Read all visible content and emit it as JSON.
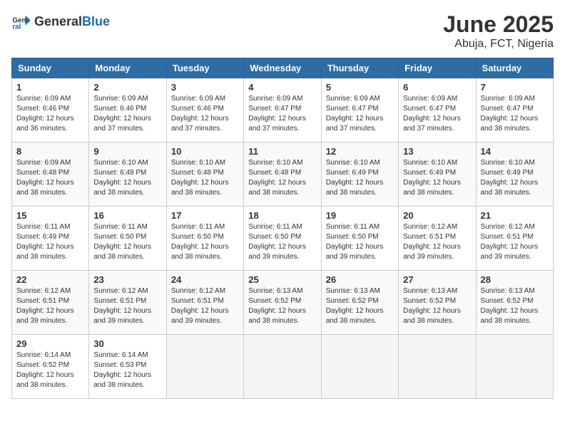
{
  "header": {
    "logo_general": "General",
    "logo_blue": "Blue",
    "title": "June 2025",
    "subtitle": "Abuja, FCT, Nigeria"
  },
  "calendar": {
    "columns": [
      "Sunday",
      "Monday",
      "Tuesday",
      "Wednesday",
      "Thursday",
      "Friday",
      "Saturday"
    ],
    "rows": [
      [
        {
          "day": "1",
          "sunrise": "6:09 AM",
          "sunset": "6:46 PM",
          "daylight": "12 hours and 36 minutes."
        },
        {
          "day": "2",
          "sunrise": "6:09 AM",
          "sunset": "6:46 PM",
          "daylight": "12 hours and 37 minutes."
        },
        {
          "day": "3",
          "sunrise": "6:09 AM",
          "sunset": "6:46 PM",
          "daylight": "12 hours and 37 minutes."
        },
        {
          "day": "4",
          "sunrise": "6:09 AM",
          "sunset": "6:47 PM",
          "daylight": "12 hours and 37 minutes."
        },
        {
          "day": "5",
          "sunrise": "6:09 AM",
          "sunset": "6:47 PM",
          "daylight": "12 hours and 37 minutes."
        },
        {
          "day": "6",
          "sunrise": "6:09 AM",
          "sunset": "6:47 PM",
          "daylight": "12 hours and 37 minutes."
        },
        {
          "day": "7",
          "sunrise": "6:09 AM",
          "sunset": "6:47 PM",
          "daylight": "12 hours and 38 minutes."
        }
      ],
      [
        {
          "day": "8",
          "sunrise": "6:09 AM",
          "sunset": "6:48 PM",
          "daylight": "12 hours and 38 minutes."
        },
        {
          "day": "9",
          "sunrise": "6:10 AM",
          "sunset": "6:48 PM",
          "daylight": "12 hours and 38 minutes."
        },
        {
          "day": "10",
          "sunrise": "6:10 AM",
          "sunset": "6:48 PM",
          "daylight": "12 hours and 38 minutes."
        },
        {
          "day": "11",
          "sunrise": "6:10 AM",
          "sunset": "6:48 PM",
          "daylight": "12 hours and 38 minutes."
        },
        {
          "day": "12",
          "sunrise": "6:10 AM",
          "sunset": "6:49 PM",
          "daylight": "12 hours and 38 minutes."
        },
        {
          "day": "13",
          "sunrise": "6:10 AM",
          "sunset": "6:49 PM",
          "daylight": "12 hours and 38 minutes."
        },
        {
          "day": "14",
          "sunrise": "6:10 AM",
          "sunset": "6:49 PM",
          "daylight": "12 hours and 38 minutes."
        }
      ],
      [
        {
          "day": "15",
          "sunrise": "6:11 AM",
          "sunset": "6:49 PM",
          "daylight": "12 hours and 38 minutes."
        },
        {
          "day": "16",
          "sunrise": "6:11 AM",
          "sunset": "6:50 PM",
          "daylight": "12 hours and 38 minutes."
        },
        {
          "day": "17",
          "sunrise": "6:11 AM",
          "sunset": "6:50 PM",
          "daylight": "12 hours and 38 minutes."
        },
        {
          "day": "18",
          "sunrise": "6:11 AM",
          "sunset": "6:50 PM",
          "daylight": "12 hours and 39 minutes."
        },
        {
          "day": "19",
          "sunrise": "6:11 AM",
          "sunset": "6:50 PM",
          "daylight": "12 hours and 39 minutes."
        },
        {
          "day": "20",
          "sunrise": "6:12 AM",
          "sunset": "6:51 PM",
          "daylight": "12 hours and 39 minutes."
        },
        {
          "day": "21",
          "sunrise": "6:12 AM",
          "sunset": "6:51 PM",
          "daylight": "12 hours and 39 minutes."
        }
      ],
      [
        {
          "day": "22",
          "sunrise": "6:12 AM",
          "sunset": "6:51 PM",
          "daylight": "12 hours and 39 minutes."
        },
        {
          "day": "23",
          "sunrise": "6:12 AM",
          "sunset": "6:51 PM",
          "daylight": "12 hours and 39 minutes."
        },
        {
          "day": "24",
          "sunrise": "6:12 AM",
          "sunset": "6:51 PM",
          "daylight": "12 hours and 39 minutes."
        },
        {
          "day": "25",
          "sunrise": "6:13 AM",
          "sunset": "6:52 PM",
          "daylight": "12 hours and 38 minutes."
        },
        {
          "day": "26",
          "sunrise": "6:13 AM",
          "sunset": "6:52 PM",
          "daylight": "12 hours and 38 minutes."
        },
        {
          "day": "27",
          "sunrise": "6:13 AM",
          "sunset": "6:52 PM",
          "daylight": "12 hours and 38 minutes."
        },
        {
          "day": "28",
          "sunrise": "6:13 AM",
          "sunset": "6:52 PM",
          "daylight": "12 hours and 38 minutes."
        }
      ],
      [
        {
          "day": "29",
          "sunrise": "6:14 AM",
          "sunset": "6:52 PM",
          "daylight": "12 hours and 38 minutes."
        },
        {
          "day": "30",
          "sunrise": "6:14 AM",
          "sunset": "6:53 PM",
          "daylight": "12 hours and 38 minutes."
        },
        null,
        null,
        null,
        null,
        null
      ]
    ]
  }
}
